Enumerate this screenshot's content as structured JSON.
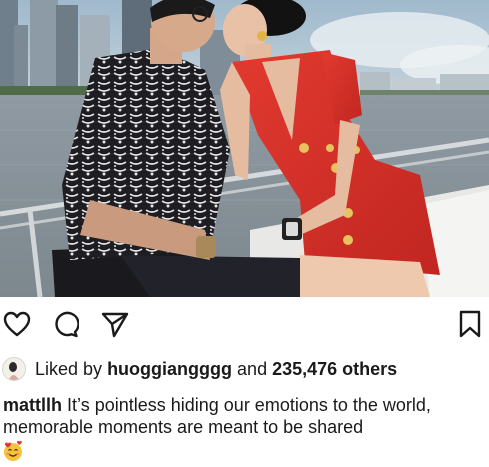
{
  "post": {
    "likes": {
      "prefix": "Liked by",
      "liker_username": "huoggiangggg",
      "connector": "and",
      "others_text": "235,476 others"
    },
    "caption": {
      "username": "mattllh",
      "text": "It’s pointless hiding our emotions to the world, memorable moments are meant to be shared",
      "emoji_icon": "smiling-face-with-hearts-icon"
    }
  },
  "actions": {
    "like_icon": "heart-icon",
    "comment_icon": "comment-bubble-icon",
    "share_icon": "paper-plane-icon",
    "save_icon": "bookmark-icon"
  },
  "colors": {
    "icon": "#1a1a1a",
    "text": "#1a1a1a",
    "dress_red": "#d9302a",
    "water": "#8e98a0",
    "sky": "#a9c2d4"
  }
}
